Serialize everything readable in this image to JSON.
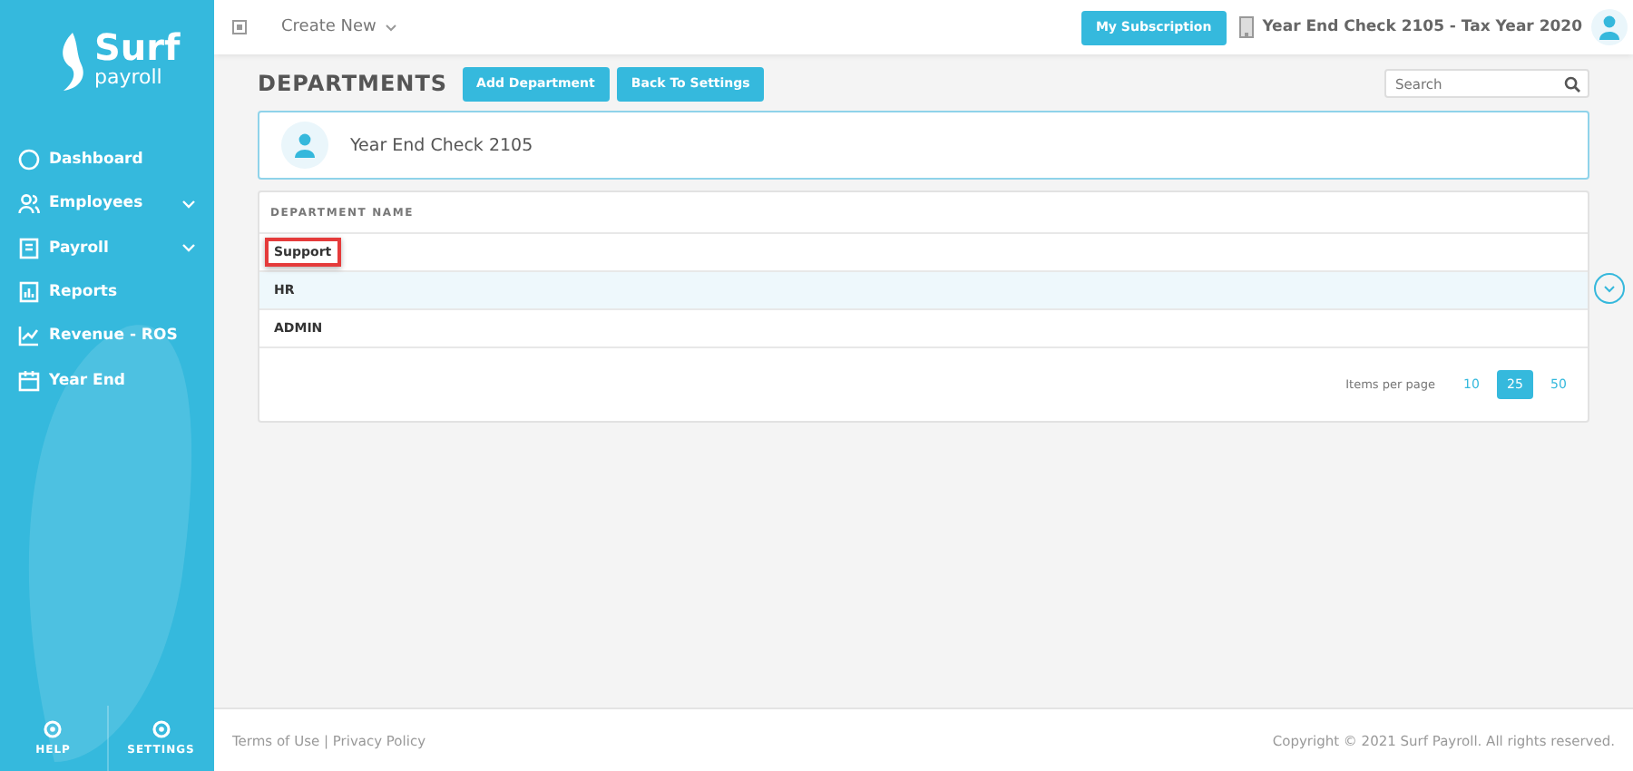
{
  "sidebar": {
    "logo_top": "Surf",
    "logo_bottom": "payroll",
    "items": [
      {
        "label": "Dashboard",
        "expandable": false
      },
      {
        "label": "Employees",
        "expandable": true
      },
      {
        "label": "Payroll",
        "expandable": true
      },
      {
        "label": "Reports",
        "expandable": false
      },
      {
        "label": "Revenue - ROS",
        "expandable": false
      },
      {
        "label": "Year End",
        "expandable": false
      }
    ],
    "bottom": [
      {
        "label": "HELP"
      },
      {
        "label": "SETTINGS"
      }
    ]
  },
  "topbar": {
    "create_new": "Create New",
    "subscription": "My Subscription",
    "company": "Year End Check 2105 - Tax Year 2020"
  },
  "page": {
    "title": "DEPARTMENTS",
    "buttons": [
      "Add Department",
      "Back To Settings"
    ],
    "search": {
      "placeholder": "Search"
    },
    "company_card": "Year End Check 2105"
  },
  "table": {
    "columns": [
      "DEPARTMENT NAME"
    ],
    "rows": [
      {
        "name": "Support",
        "highlighted": false,
        "marked": true
      },
      {
        "name": "HR",
        "highlighted": true,
        "marked": false
      },
      {
        "name": "ADMIN",
        "highlighted": false,
        "marked": false
      }
    ]
  },
  "pagination": {
    "label": "Items per page",
    "options": [
      {
        "label": "10",
        "selected": false
      },
      {
        "label": "25",
        "selected": true
      },
      {
        "label": "50",
        "selected": false
      }
    ]
  },
  "footer": {
    "links": "Terms of Use | Privacy Policy",
    "copyright": "Copyright © 2021 Surf Payroll. All rights reserved."
  }
}
